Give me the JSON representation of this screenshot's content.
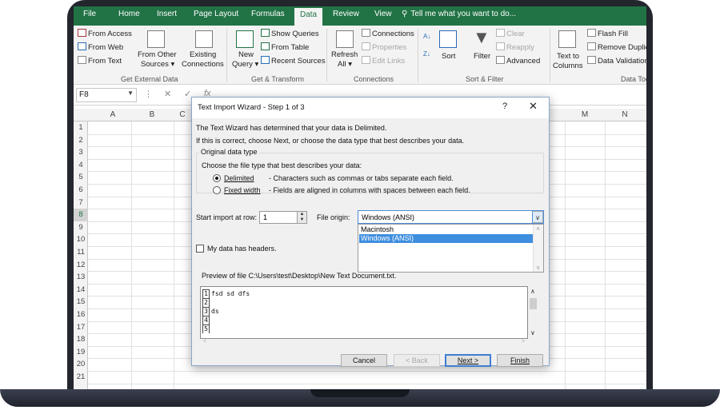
{
  "ribbon_tabs": [
    "File",
    "Home",
    "Insert",
    "Page Layout",
    "Formulas",
    "Data",
    "Review",
    "View"
  ],
  "active_tab": "Data",
  "tell_me": "Tell me what you want to do...",
  "ribbon": {
    "get_external_data": {
      "from_access": "From Access",
      "from_web": "From Web",
      "from_text": "From Text",
      "from_other_1": "From Other",
      "from_other_2": "Sources ▾",
      "existing_1": "Existing",
      "existing_2": "Connections",
      "group_label": "Get External Data"
    },
    "get_transform": {
      "new_query_1": "New",
      "new_query_2": "Query ▾",
      "show_queries": "Show Queries",
      "from_table": "From Table",
      "recent_sources": "Recent Sources",
      "group_label": "Get & Transform"
    },
    "connections": {
      "refresh_1": "Refresh",
      "refresh_2": "All ▾",
      "connections": "Connections",
      "properties": "Properties",
      "edit_links": "Edit Links",
      "group_label": "Connections"
    },
    "sort_filter": {
      "sort": "Sort",
      "filter": "Filter",
      "clear": "Clear",
      "reapply": "Reapply",
      "advanced": "Advanced",
      "group_label": "Sort & Filter"
    },
    "data_tools": {
      "text_to_1": "Text to",
      "text_to_2": "Columns",
      "flash_fill": "Flash Fill",
      "remove_dup": "Remove Duplica",
      "data_validation": "Data Validation",
      "group_label": "Data Too"
    }
  },
  "name_box": "F8",
  "formula_buttons": {
    "cancel": "✕",
    "enter": "✓",
    "fx": "fx"
  },
  "columns": [
    "A",
    "B",
    "C",
    "M",
    "N"
  ],
  "rows": [
    "1",
    "2",
    "3",
    "4",
    "5",
    "6",
    "7",
    "8",
    "9",
    "10",
    "11",
    "12",
    "13",
    "14",
    "15",
    "16",
    "17",
    "18",
    "19",
    "20",
    "21"
  ],
  "selected_row": "8",
  "dialog": {
    "title": "Text Import Wizard - Step 1 of 3",
    "help": "?",
    "close": "✕",
    "line1": "The Text Wizard has determined that your data is Delimited.",
    "line2": "If this is correct, choose Next, or choose the data type that best describes your data.",
    "group_label": "Original data type",
    "choose_label": "Choose the file type that best describes your data:",
    "delimited": "Delimited",
    "delimited_desc": "- Characters such as commas or tabs separate each field.",
    "fixed_width": "Fixed width",
    "fixed_desc": "- Fields are aligned in columns with spaces between each field.",
    "selected_type": "Delimited",
    "start_row_label": "Start import at row:",
    "start_row": "1",
    "file_origin_label": "File origin:",
    "file_origin": "Windows (ANSI)",
    "origin_options": [
      "Macintosh",
      "Windows (ANSI)"
    ],
    "headers_label": "My data has headers.",
    "headers_checked": false,
    "preview_label": "Preview of file C:\\Users\\test\\Desktop\\New Text Document.txt.",
    "preview_lines": [
      {
        "n": "1",
        "text": "fsd sd dfs"
      },
      {
        "n": "2",
        "text": ""
      },
      {
        "n": "3",
        "text": "ds"
      },
      {
        "n": "4",
        "text": ""
      },
      {
        "n": "5",
        "text": ""
      }
    ],
    "buttons": {
      "cancel": "Cancel",
      "back": "< Back",
      "next": "Next >",
      "finish": "Finish"
    }
  },
  "colors": {
    "excel_green": "#217346",
    "selection_blue": "#3e8edf",
    "accent_border": "#3c7fd3"
  }
}
